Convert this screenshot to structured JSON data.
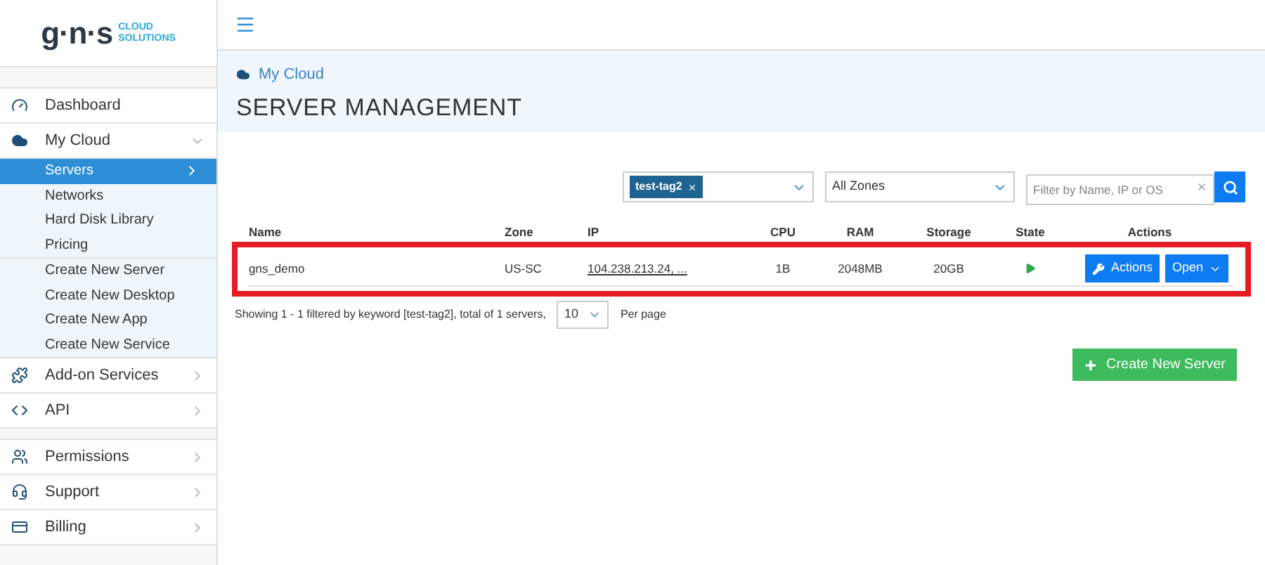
{
  "logo": {
    "mark": "g·n·s",
    "tagline_1": "CLOUD",
    "tagline_2": "SOLUTIONS"
  },
  "sidebar": {
    "sections": [
      {
        "items": [
          {
            "label": "Dashboard"
          },
          {
            "label": "My Cloud",
            "expanded": true,
            "children": [
              {
                "label": "Servers",
                "selected": true
              },
              {
                "label": "Networks",
                "selected": false
              },
              {
                "label": "Hard Disk Library",
                "selected": false
              },
              {
                "label": "Pricing",
                "selected": false
              }
            ],
            "shortcuts": [
              {
                "label": "Create New Server"
              },
              {
                "label": "Create New Desktop"
              },
              {
                "label": "Create New App"
              },
              {
                "label": "Create New Service"
              }
            ]
          },
          {
            "label": "Add-on Services",
            "expanded": false
          },
          {
            "label": "API",
            "expanded": false
          }
        ]
      },
      {
        "items": [
          {
            "label": "Permissions",
            "expanded": false
          },
          {
            "label": "Support",
            "expanded": false
          },
          {
            "label": "Billing",
            "expanded": false
          }
        ]
      }
    ]
  },
  "breadcrumb": "My Cloud",
  "page_title": "SERVER MANAGEMENT",
  "filters": {
    "tags": [
      "test-tag2"
    ],
    "zone": "All Zones",
    "search": {
      "placeholder": "Filter by Name, IP or OS"
    }
  },
  "table": {
    "columns": [
      "Name",
      "Zone",
      "IP",
      "CPU",
      "RAM",
      "Storage",
      "State",
      "Actions"
    ],
    "rows": [
      {
        "name": "gns_demo",
        "zone": "US-SC",
        "ip": "104.238.213.24, ...",
        "cpu": "1B",
        "ram": "2048MB",
        "storage": "20GB",
        "running": true,
        "highlighted": true,
        "actions": "Actions",
        "open": "Open"
      }
    ]
  },
  "pagination": {
    "summary": "Showing 1 - 1 filtered by keyword [test-tag2], total of 1 servers,",
    "per_page": "10",
    "per_page_label": "Per page"
  },
  "create_button": "Create New Server"
}
